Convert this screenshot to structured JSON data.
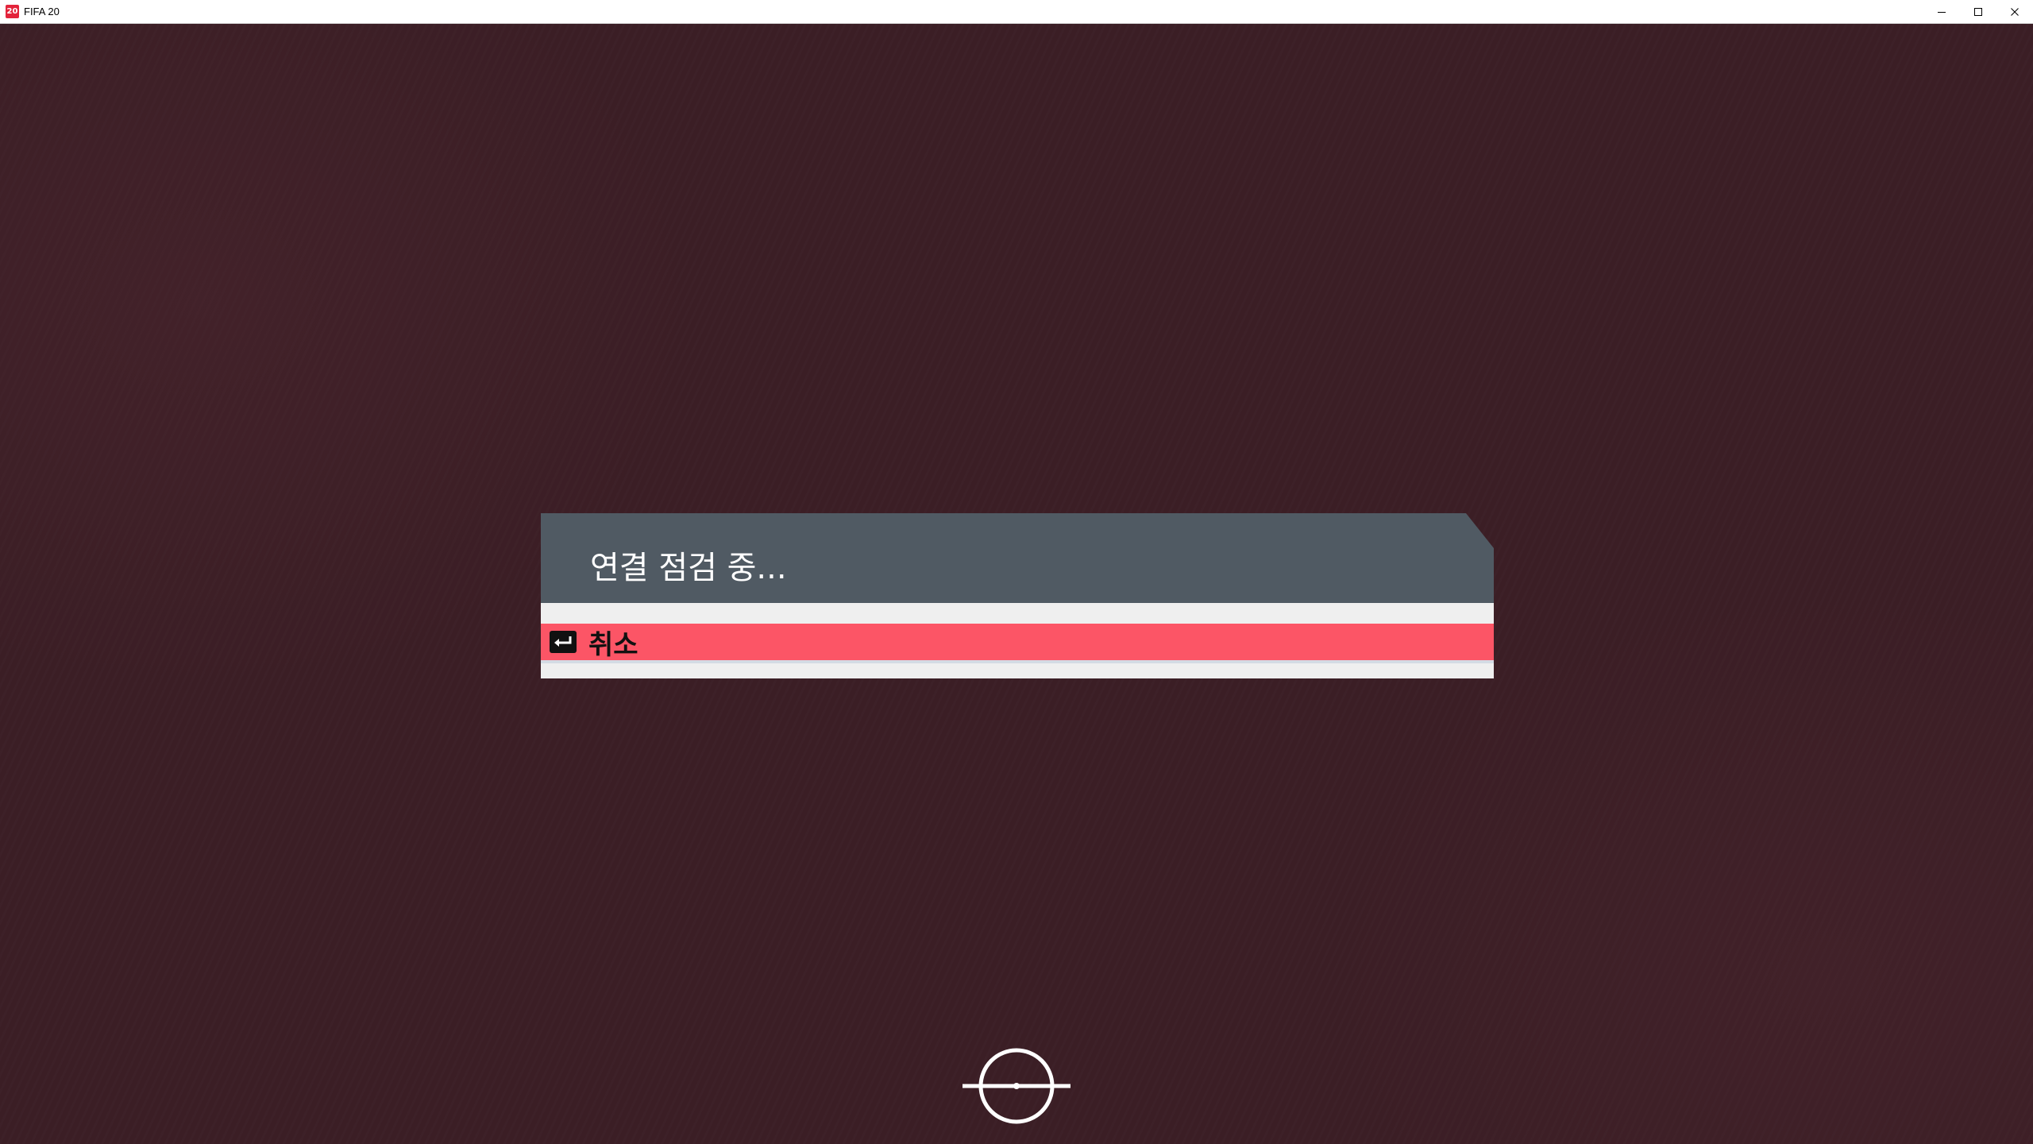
{
  "window": {
    "title": "FIFA 20",
    "app_icon_text": "20",
    "controls": [
      "minimize-icon",
      "maximize-icon",
      "close-icon"
    ]
  },
  "dialog": {
    "title": "연결 점검 중...",
    "options": [
      {
        "label": "취소",
        "icon": "return-arrow-icon",
        "selected": true
      }
    ]
  },
  "colors": {
    "background": "#3b1e25",
    "dialog_header": "#505a63",
    "dialog_body": "#efefef",
    "selected_option": "#fc5566",
    "titlebar": "#ffffff"
  },
  "indicator": {
    "icon": "loading-spinner-icon"
  }
}
